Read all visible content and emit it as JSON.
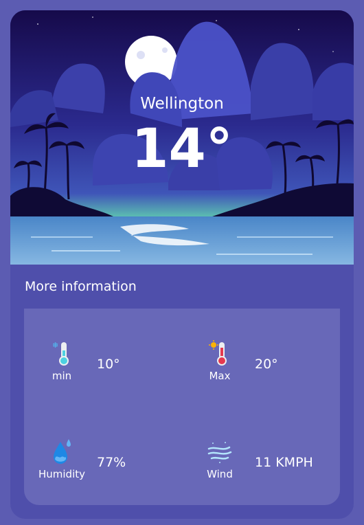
{
  "weather": {
    "city": "Wellington",
    "temperature": "14°"
  },
  "details": {
    "title": "More information",
    "items": [
      {
        "icon": "thermometer-cold-icon",
        "label": "min",
        "value": "10°"
      },
      {
        "icon": "thermometer-hot-icon",
        "label": "Max",
        "value": "20°"
      },
      {
        "icon": "humidity-drop-icon",
        "label": "Humidity",
        "value": "77%"
      },
      {
        "icon": "wind-icon",
        "label": "Wind",
        "value": "11 KMPH"
      }
    ]
  },
  "colors": {
    "page_bg": "#5c5cb2",
    "card_bg": "#4f4fab",
    "panel_bg": "#6868b8",
    "text": "#ffffff"
  }
}
